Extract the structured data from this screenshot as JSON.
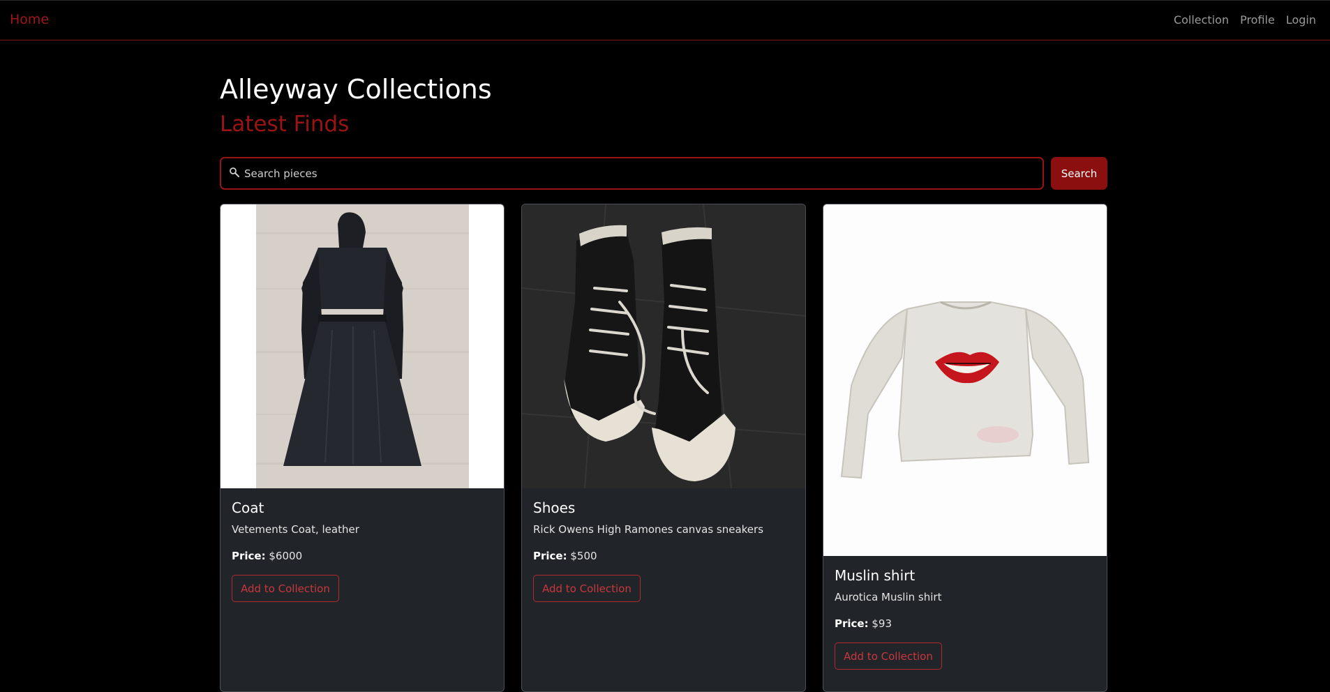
{
  "nav": {
    "brand": "Home",
    "links": [
      "Collection",
      "Profile",
      "Login"
    ]
  },
  "header": {
    "title": "Alleyway Collections",
    "subtitle": "Latest Finds"
  },
  "search": {
    "placeholder": "Search pieces",
    "value": "",
    "button_label": "Search",
    "icon": "search-icon"
  },
  "price_label": "Price:",
  "items": [
    {
      "title": "Coat",
      "description": "Vetements Coat, leather",
      "price": "$6000",
      "button_label": "Add to Collection",
      "image": "black-leather-coat-photo"
    },
    {
      "title": "Shoes",
      "description": "Rick Owens High Ramones canvas sneakers",
      "price": "$500",
      "button_label": "Add to Collection",
      "image": "black-canvas-sneakers-photo"
    },
    {
      "title": "Muslin shirt",
      "description": "Aurotica Muslin shirt",
      "price": "$93",
      "button_label": "Add to Collection",
      "image": "white-shirt-lips-print-photo"
    }
  ],
  "colors": {
    "accent": "#8c0f0f",
    "brand": "#a0161a",
    "card_background": "#212529",
    "page_background": "#000000"
  }
}
